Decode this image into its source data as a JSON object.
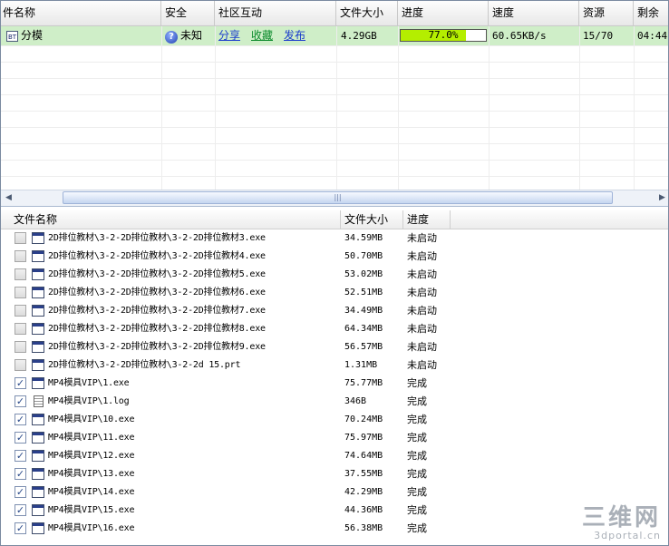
{
  "task_list": {
    "columns": [
      "件名称",
      "安全",
      "社区互动",
      "文件大小",
      "进度",
      "速度",
      "资源",
      "剩余"
    ],
    "task": {
      "type_icon": "BT",
      "name": "分模",
      "security_icon": "question-shield-icon",
      "security": "未知",
      "share": "分享",
      "favorite": "收藏",
      "publish": "发布",
      "size": "4.29GB",
      "progress": 0.77,
      "progress_text": "77.0%",
      "speed": "60.65KB/s",
      "sources": "15/70",
      "remaining": "04:44"
    }
  },
  "scrollbar": {
    "left_arrow": "◀",
    "right_arrow": "▶",
    "grip": "|||"
  },
  "file_list": {
    "columns": [
      "文件名称",
      "文件大小",
      "进度"
    ],
    "files": [
      {
        "checked": false,
        "icon": "exe-file-icon",
        "name": "2D排位教材\\3-2-2D排位教材\\3-2-2D排位教材3.exe",
        "size": "34.59MB",
        "status": "未启动"
      },
      {
        "checked": false,
        "icon": "exe-file-icon",
        "name": "2D排位教材\\3-2-2D排位教材\\3-2-2D排位教材4.exe",
        "size": "50.70MB",
        "status": "未启动"
      },
      {
        "checked": false,
        "icon": "exe-file-icon",
        "name": "2D排位教材\\3-2-2D排位教材\\3-2-2D排位教材5.exe",
        "size": "53.02MB",
        "status": "未启动"
      },
      {
        "checked": false,
        "icon": "exe-file-icon",
        "name": "2D排位教材\\3-2-2D排位教材\\3-2-2D排位教材6.exe",
        "size": "52.51MB",
        "status": "未启动"
      },
      {
        "checked": false,
        "icon": "exe-file-icon",
        "name": "2D排位教材\\3-2-2D排位教材\\3-2-2D排位教材7.exe",
        "size": "34.49MB",
        "status": "未启动"
      },
      {
        "checked": false,
        "icon": "exe-file-icon",
        "name": "2D排位教材\\3-2-2D排位教材\\3-2-2D排位教材8.exe",
        "size": "64.34MB",
        "status": "未启动"
      },
      {
        "checked": false,
        "icon": "exe-file-icon",
        "name": "2D排位教材\\3-2-2D排位教材\\3-2-2D排位教材9.exe",
        "size": "56.57MB",
        "status": "未启动"
      },
      {
        "checked": false,
        "icon": "exe-file-icon",
        "name": "2D排位教材\\3-2-2D排位教材\\3-2-2d    15.prt",
        "size": "1.31MB",
        "status": "未启动"
      },
      {
        "checked": true,
        "icon": "exe-file-icon",
        "name": "MP4模具VIP\\1.exe",
        "size": "75.77MB",
        "status": "完成"
      },
      {
        "checked": true,
        "icon": "log-file-icon",
        "name": "MP4模具VIP\\1.log",
        "size": "346B",
        "status": "完成"
      },
      {
        "checked": true,
        "icon": "exe-file-icon",
        "name": "MP4模具VIP\\10.exe",
        "size": "70.24MB",
        "status": "完成"
      },
      {
        "checked": true,
        "icon": "exe-file-icon",
        "name": "MP4模具VIP\\11.exe",
        "size": "75.97MB",
        "status": "完成"
      },
      {
        "checked": true,
        "icon": "exe-file-icon",
        "name": "MP4模具VIP\\12.exe",
        "size": "74.64MB",
        "status": "完成"
      },
      {
        "checked": true,
        "icon": "exe-file-icon",
        "name": "MP4模具VIP\\13.exe",
        "size": "37.55MB",
        "status": "完成"
      },
      {
        "checked": true,
        "icon": "exe-file-icon",
        "name": "MP4模具VIP\\14.exe",
        "size": "42.29MB",
        "status": "完成"
      },
      {
        "checked": true,
        "icon": "exe-file-icon",
        "name": "MP4模具VIP\\15.exe",
        "size": "44.36MB",
        "status": "完成"
      },
      {
        "checked": true,
        "icon": "exe-file-icon",
        "name": "MP4模具VIP\\16.exe",
        "size": "56.38MB",
        "status": "完成"
      }
    ]
  },
  "watermark": {
    "logo": "三维网",
    "site": "3dportal.cn"
  },
  "colors": {
    "selected_row": "#cfeec8",
    "progress_fill": "#b4ee00",
    "link_blue": "#1a3ccc",
    "link_green": "#0a8a2a"
  }
}
